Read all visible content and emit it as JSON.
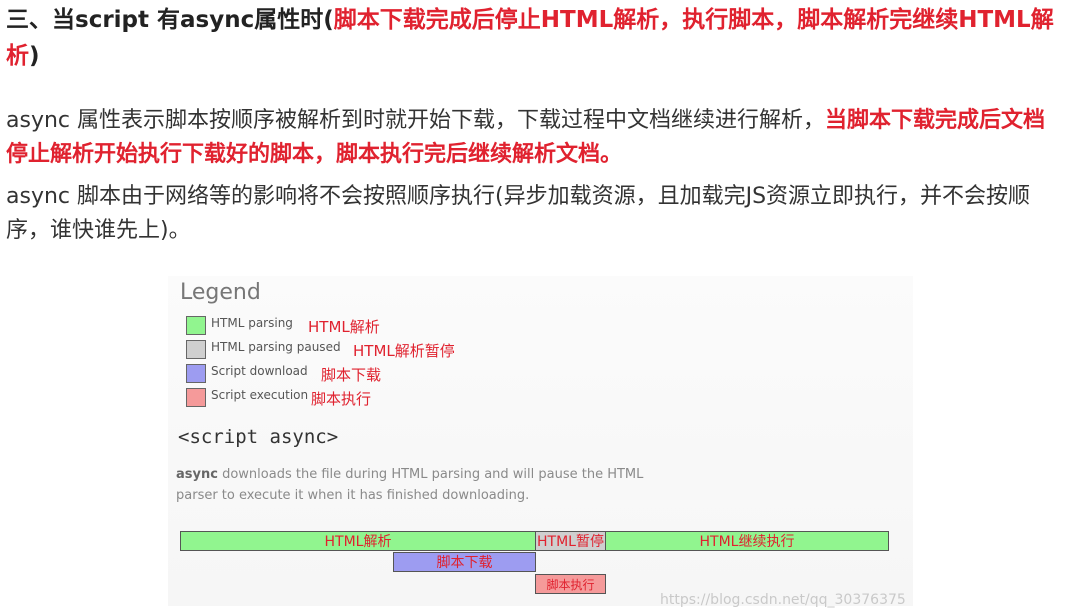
{
  "heading": {
    "prefix": "三、当script 有async属性时(",
    "red": "脚本下载完成后停止HTML解析，执行脚本，脚本解析完继续HTML解析",
    "suffix": ")"
  },
  "para1": {
    "text": "async 属性表示脚本按顺序被解析到时就开始下载，下载过程中文档继续进行解析，",
    "red": "当脚本下载完成后文档停止解析开始执行下载好的脚本，脚本执行完后继续解析文档。"
  },
  "para2": {
    "text": "async 脚本由于网络等的影响将不会按照顺序执行(异步加载资源，且加载完JS资源立即执行，并不会按顺序，谁快谁先上)。"
  },
  "figure": {
    "legend_title": "Legend",
    "legend": [
      {
        "en": "HTML parsing",
        "zh": "HTML解析",
        "color": "#91f58f"
      },
      {
        "en": "HTML parsing paused",
        "zh": "HTML解析暂停",
        "color": "#cfcfcf"
      },
      {
        "en": "Script download",
        "zh": "脚本下载",
        "color": "#9d9cf1"
      },
      {
        "en": "Script execution",
        "zh": "脚本执行",
        "color": "#f59a9a"
      }
    ],
    "code_title": "<script async>",
    "desc_keyword": "async",
    "desc_text": " downloads the file during HTML parsing and will pause the HTML parser to execute it when it has finished downloading.",
    "bars": {
      "parse1": "HTML解析",
      "pause": "HTML暂停",
      "parse2": "HTML继续执行",
      "download": "脚本下载",
      "execute": "脚本执行"
    },
    "watermark": "https://blog.csdn.net/qq_30376375"
  }
}
